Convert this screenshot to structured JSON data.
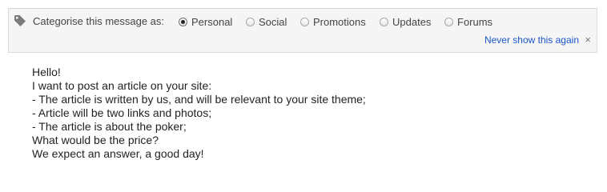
{
  "categorise": {
    "label": "Categorise this message as:",
    "options": [
      {
        "label": "Personal",
        "checked": true
      },
      {
        "label": "Social",
        "checked": false
      },
      {
        "label": "Promotions",
        "checked": false
      },
      {
        "label": "Updates",
        "checked": false
      },
      {
        "label": "Forums",
        "checked": false
      }
    ],
    "never_show_label": "Never show this again",
    "close_glyph": "×",
    "tag_icon": "tag-icon",
    "link_color": "#1a55c8"
  },
  "message": {
    "lines": [
      "Hello!",
      "I want to post an article on your site:",
      "- The article is written by us, and will be relevant to your site theme;",
      "- Article will be two links and photos;",
      "- The article is about the poker;",
      "What would be the price?",
      "We expect an answer, a good day!"
    ]
  }
}
